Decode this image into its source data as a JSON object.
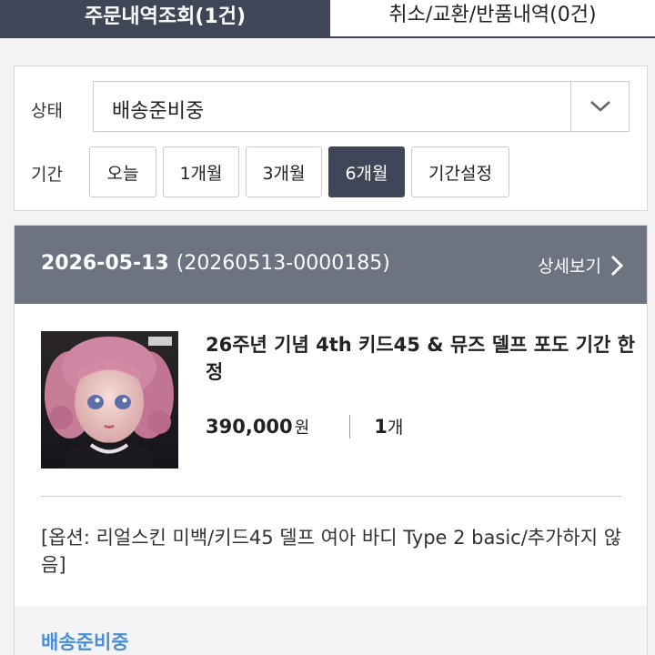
{
  "tabs": {
    "orders_label": "주문내역조회(1건)",
    "returns_label": "취소/교환/반품내역(0건)"
  },
  "filter": {
    "status_label": "상태",
    "status_value": "배송준비중",
    "period_label": "기간",
    "period_buttons": [
      "오늘",
      "1개월",
      "3개월",
      "6개월",
      "기간설정"
    ],
    "period_selected": "6개월"
  },
  "order": {
    "date": "2026-05-13",
    "order_number": "(20260513-0000185)",
    "detail_label": "상세보기",
    "product_name": "26주년 기념 4th 키드45 & 뮤즈 델프 포도 기간 한정",
    "price": "390,000",
    "price_unit": "원",
    "quantity": "1",
    "quantity_unit": "개",
    "options": "[옵션: 리얼스킨 미백/키드45 델프 여아 바디 Type 2 basic/추가하지 않음]",
    "status": "배송준비중"
  },
  "colors": {
    "active_tab": "#3e4658",
    "order_header": "#6d7380",
    "status_text": "#4a8fd6"
  }
}
